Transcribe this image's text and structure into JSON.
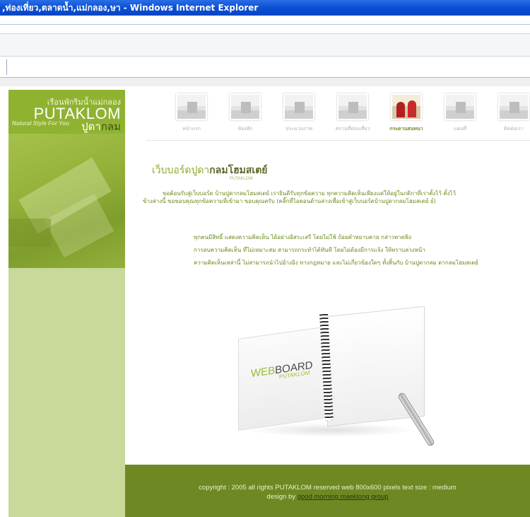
{
  "window": {
    "title": ",ท่องเที่ยว,ตลาดน้ำ,แม่กลอง,ษา - Windows Internet Explorer"
  },
  "sidebar": {
    "logo_line1": "เรือนพักริมน้ำแม่กลอง",
    "logo_brand": "PUTAKLOM",
    "logo_slogan": "Natural Style For You",
    "logo_thai_a": "ปูดา",
    "logo_thai_b": "กลม"
  },
  "nav": {
    "items": [
      {
        "label": "หน้าแรก",
        "active": false
      },
      {
        "label": "ห้องพัก",
        "active": false
      },
      {
        "label": "ประมวลภาพ",
        "active": false
      },
      {
        "label": "สถานที่ท่องเที่ยว",
        "active": false
      },
      {
        "label": "กระดานสนทนา",
        "active": true
      },
      {
        "label": "แผนที่",
        "active": false
      },
      {
        "label": "ติดต่อเรา",
        "active": false
      }
    ]
  },
  "content": {
    "title_a": "เว็บบอร์ดปูดา",
    "title_b": "กลมโฮมสเตย์",
    "subtitle": "PUTAKLOM",
    "intro_1": "ขอต้อนรับสู่เว็บบอร์ด บ้านปูดากลมโฮมสเตย์ เรายินดีรับทุกข้อความ ทุกความคิดเห็นเพียงแต่ให้อยู่ในกติกาที่เราตั้งไว้ ตั้งไว้",
    "intro_2": "ข้างล่างนี้ ขอขอบคุณทุกข้อความที่เข้ามา ขอบคุณครับ (คลิ๊กที่ไอคอนด้านล่างเพื่อเข้าสู่เว็บบอร์ดบ้านปูดากลมโฮมสเตย์ ย์)",
    "rule_1": "ทุกคนมีสิทธิ์ แสดงความคิดเห็น ได้อย่างอิสระเสรี โดยไม่ใช้ ถ้อยคำหยาบคาย กล่าวพาดพิง",
    "rule_2": "การลบความคิดเห็น ที่ไม่เหมาะสม สามารถกระทำได้ทันที โดยไม่ต้องมีการแจ้ง ให้ทราบล่วงหน้า",
    "rule_3": "ความคิดเห็นเหล่านี้ ไม่สามารถนำไปอ้างอิง ทางกฎหมาย และไม่เกี่ยวข้องใดๆ ทั้งสิ้นกับ บ้านปูดากลม ดากลมโฮมสเตย์"
  },
  "notebook": {
    "word_a": "WEB",
    "word_b": "BOARD",
    "word_c": "PUTAKLOM"
  },
  "footer": {
    "line1": "copyright : 2005 all rights PUTAKLOM reserved web 800x600 pixels text size : medium",
    "line2_prefix": "design by ",
    "line2_link": "good morning maeklong group"
  },
  "colors": {
    "titlebar": "#0a4fd4",
    "brand_green": "#8fb331",
    "footer_green": "#6e8924",
    "text_green": "#6b8a1b"
  }
}
